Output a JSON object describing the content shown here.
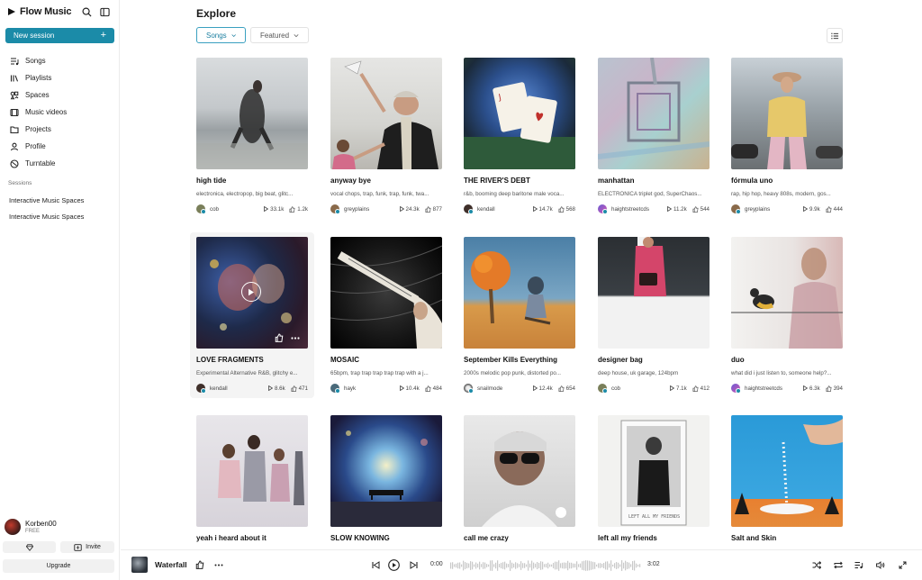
{
  "app": {
    "name": "Flow Music"
  },
  "sidebar": {
    "new_session_label": "New session",
    "nav": [
      {
        "label": "Songs",
        "icon": "songs-icon"
      },
      {
        "label": "Playlists",
        "icon": "playlists-icon"
      },
      {
        "label": "Spaces",
        "icon": "spaces-icon"
      },
      {
        "label": "Music videos",
        "icon": "music-videos-icon"
      },
      {
        "label": "Projects",
        "icon": "projects-icon"
      },
      {
        "label": "Profile",
        "icon": "profile-icon"
      },
      {
        "label": "Turntable",
        "icon": "turntable-icon"
      }
    ],
    "sessions_title": "Sessions",
    "sessions": [
      "Interactive Music Spaces",
      "Interactive Music Spaces"
    ],
    "user": {
      "name": "Korben00",
      "plan": "FREE"
    },
    "invite_label": "Invite",
    "upgrade_label": "Upgrade"
  },
  "main": {
    "title": "Explore",
    "filters": {
      "active": "Songs",
      "secondary": "Featured"
    },
    "cards": [
      {
        "title": "high tide",
        "desc": "electronica, electropop, big beat, glitc...",
        "author": "cob",
        "plays": "33.1k",
        "likes": "1.2k"
      },
      {
        "title": "anyway bye",
        "desc": "vocal chops, trap, funk, trap, funk, twa...",
        "author": "greyplains",
        "plays": "24.3k",
        "likes": "877"
      },
      {
        "title": "THE RIVER'S DEBT",
        "desc": "r&b, booming deep baritone male voca...",
        "author": "kendall",
        "plays": "14.7k",
        "likes": "568"
      },
      {
        "title": "manhattan",
        "desc": "ELECTRONICA triplet god, SuperChaos...",
        "author": "haightstreetcds",
        "plays": "11.2k",
        "likes": "544"
      },
      {
        "title": "fórmula uno",
        "desc": "rap, hip hop, heavy 808s, modern, gos...",
        "author": "greyplains",
        "plays": "9.9k",
        "likes": "444"
      },
      {
        "title": "LOVE FRAGMENTS",
        "desc": "Experimental Alternative R&B, glitchy e...",
        "author": "kendall",
        "plays": "8.6k",
        "likes": "471"
      },
      {
        "title": "MOSAIC",
        "desc": "65bpm, trap trap trap trap trap with a j...",
        "author": "hayk",
        "plays": "10.4k",
        "likes": "484"
      },
      {
        "title": "September Kills Everything",
        "desc": "2000s melodic pop punk, distorted po...",
        "author": "snailmode",
        "plays": "12.4k",
        "likes": "654"
      },
      {
        "title": "designer bag",
        "desc": "deep house, uk garage, 124bpm",
        "author": "cob",
        "plays": "7.1k",
        "likes": "412"
      },
      {
        "title": "duo",
        "desc": "what did i just listen to, someone help?...",
        "author": "haightstreetcds",
        "plays": "6.3k",
        "likes": "394"
      },
      {
        "title": "yeah i heard about it"
      },
      {
        "title": "SLOW KNOWING"
      },
      {
        "title": "call me crazy"
      },
      {
        "title": "left all my friends"
      },
      {
        "title": "Salt and Skin"
      }
    ]
  },
  "player": {
    "title": "Waterfall",
    "current_time": "0:00",
    "duration": "3:02"
  },
  "colors": {
    "accent": "#1b8ba8"
  }
}
